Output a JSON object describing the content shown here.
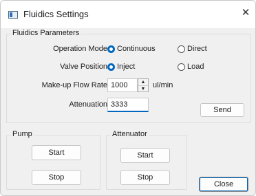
{
  "window": {
    "title": "Fluidics Settings",
    "close_glyph": "✕"
  },
  "fluidics_parameters": {
    "legend": "Fluidics Parameters",
    "operation_mode": {
      "label": "Operation Mode",
      "options": [
        {
          "label": "Continuous",
          "selected": true
        },
        {
          "label": "Direct",
          "selected": false
        }
      ]
    },
    "valve_position": {
      "label": "Valve Position",
      "options": [
        {
          "label": "Inject",
          "selected": true
        },
        {
          "label": "Load",
          "selected": false
        }
      ]
    },
    "makeup_flow_rate": {
      "label": "Make-up Flow Rate",
      "value": "1000",
      "unit": "ul/min"
    },
    "attenuation": {
      "label": "Attenuation",
      "value": "3333"
    },
    "send_label": "Send"
  },
  "pump": {
    "legend": "Pump",
    "start_label": "Start",
    "stop_label": "Stop"
  },
  "attenuator": {
    "legend": "Attenuator",
    "start_label": "Start",
    "stop_label": "Stop"
  },
  "close_label": "Close",
  "colors": {
    "accent": "#0067c0",
    "window_bg": "#f0f0f0",
    "titlebar_bg": "#ffffff"
  }
}
